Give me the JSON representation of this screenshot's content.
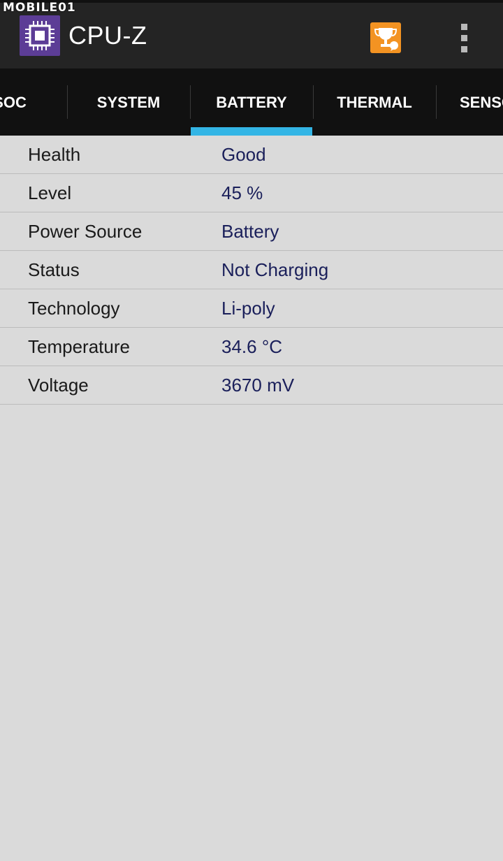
{
  "watermark": "MOBILE01",
  "app": {
    "title": "CPU-Z"
  },
  "tabs": [
    {
      "label": "SOC"
    },
    {
      "label": "SYSTEM"
    },
    {
      "label": "BATTERY",
      "active": true
    },
    {
      "label": "THERMAL"
    },
    {
      "label": "SENSORS"
    }
  ],
  "battery": {
    "rows": [
      {
        "label": "Health",
        "value": "Good"
      },
      {
        "label": "Level",
        "value": "45 %"
      },
      {
        "label": "Power Source",
        "value": "Battery"
      },
      {
        "label": "Status",
        "value": "Not Charging"
      },
      {
        "label": "Technology",
        "value": "Li-poly"
      },
      {
        "label": "Temperature",
        "value": "34.6 °C"
      },
      {
        "label": "Voltage",
        "value": "3670 mV"
      }
    ]
  },
  "icons": {
    "app_logo": "cpu-chip-icon",
    "trophy": "trophy-icon",
    "overflow": "overflow-menu-icon"
  },
  "colors": {
    "accent": "#33b5e5",
    "logo_bg": "#5c3d96",
    "trophy_bg": "#f39322",
    "value_text": "#1a1f5a"
  }
}
